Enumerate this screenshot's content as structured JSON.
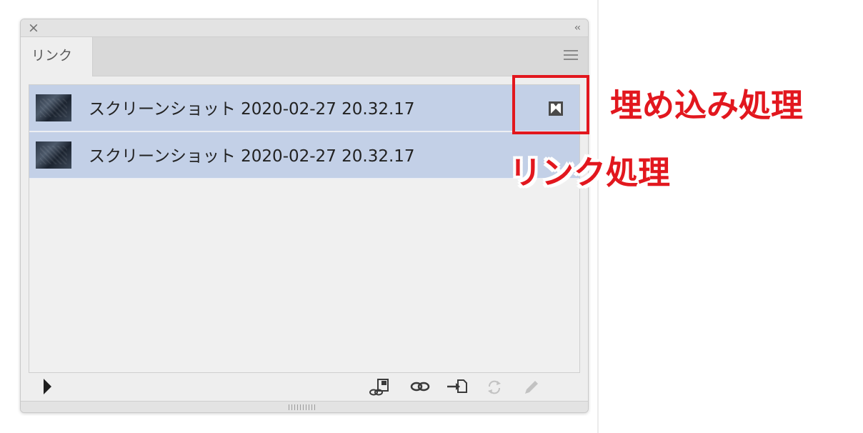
{
  "panel": {
    "close_glyph": "×",
    "collapse_glyph": "‹‹",
    "tab_label": "リンク"
  },
  "links": [
    {
      "name": "スクリーンショット 2020-02-27 20.32.17",
      "status_icon": "embedded-icon"
    },
    {
      "name": "スクリーンショット 2020-02-27 20.32.17",
      "status_icon": ""
    }
  ],
  "toolbar": {
    "tools": [
      "relink-from-cc-libraries-icon",
      "relink-icon",
      "go-to-link-icon",
      "update-link-icon",
      "edit-original-icon"
    ]
  },
  "annotations": {
    "embed_label": "埋め込み処理",
    "link_label": "リンク処理"
  },
  "colors": {
    "annotation_red": "#e2171e",
    "row_selected": "#c3d0e7",
    "panel_bg": "#eeeeee"
  }
}
